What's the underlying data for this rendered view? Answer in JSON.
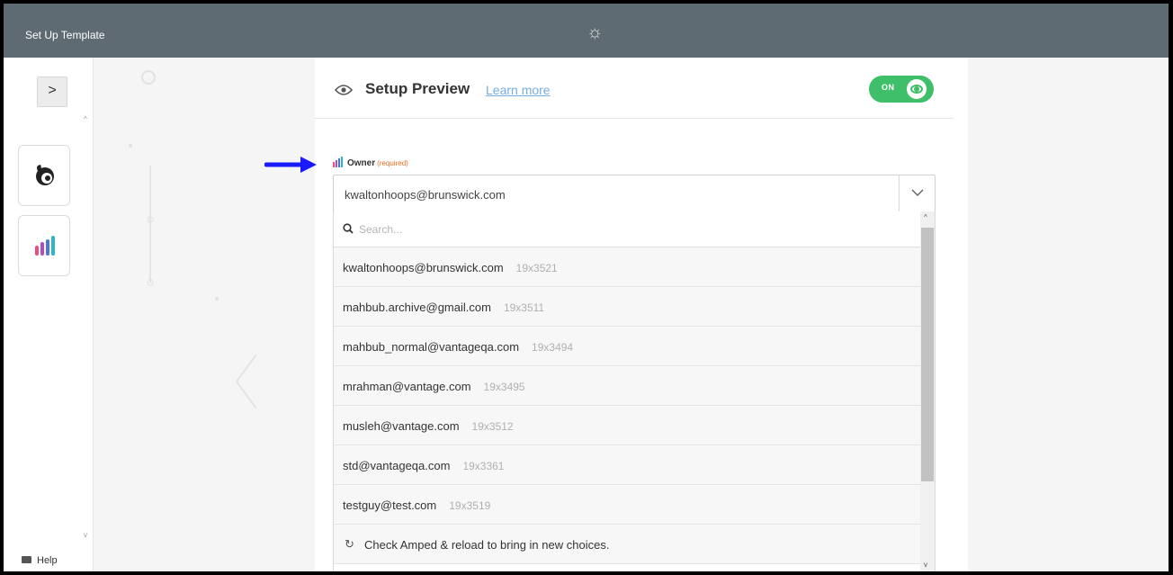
{
  "window": {
    "title": "Set Up Template",
    "center_icon": "sun-icon"
  },
  "sidebar": {
    "expand_icon": "chevron-right-icon",
    "apps": [
      {
        "icon": "mailchimp-logo-icon"
      },
      {
        "icon": "bar-logo-icon"
      }
    ],
    "help_label": "Help"
  },
  "preview": {
    "title": "Setup Preview",
    "learn_more": "Learn more",
    "toggle_label": "ON",
    "toggle_color": "#3fbf6a"
  },
  "owner": {
    "label": "Owner",
    "required": "(required)",
    "selected": "kwaltonhoops@brunswick.com",
    "search_placeholder": "Search...",
    "options": [
      {
        "email": "kwaltonhoops@brunswick.com",
        "id": "19x3521"
      },
      {
        "email": "mahbub.archive@gmail.com",
        "id": "19x3511"
      },
      {
        "email": "mahbub_normal@vantageqa.com",
        "id": "19x3494"
      },
      {
        "email": "mrahman@vantage.com",
        "id": "19x3495"
      },
      {
        "email": "musleh@vantage.com",
        "id": "19x3512"
      },
      {
        "email": "std@vantageqa.com",
        "id": "19x3361"
      },
      {
        "email": "testguy@test.com",
        "id": "19x3519"
      }
    ],
    "reload_text": "Check Amped & reload to bring in new choices."
  },
  "colors": {
    "accent_required": "#f06b20",
    "link": "#74aee0",
    "annotation_arrow": "#1a1aff"
  }
}
